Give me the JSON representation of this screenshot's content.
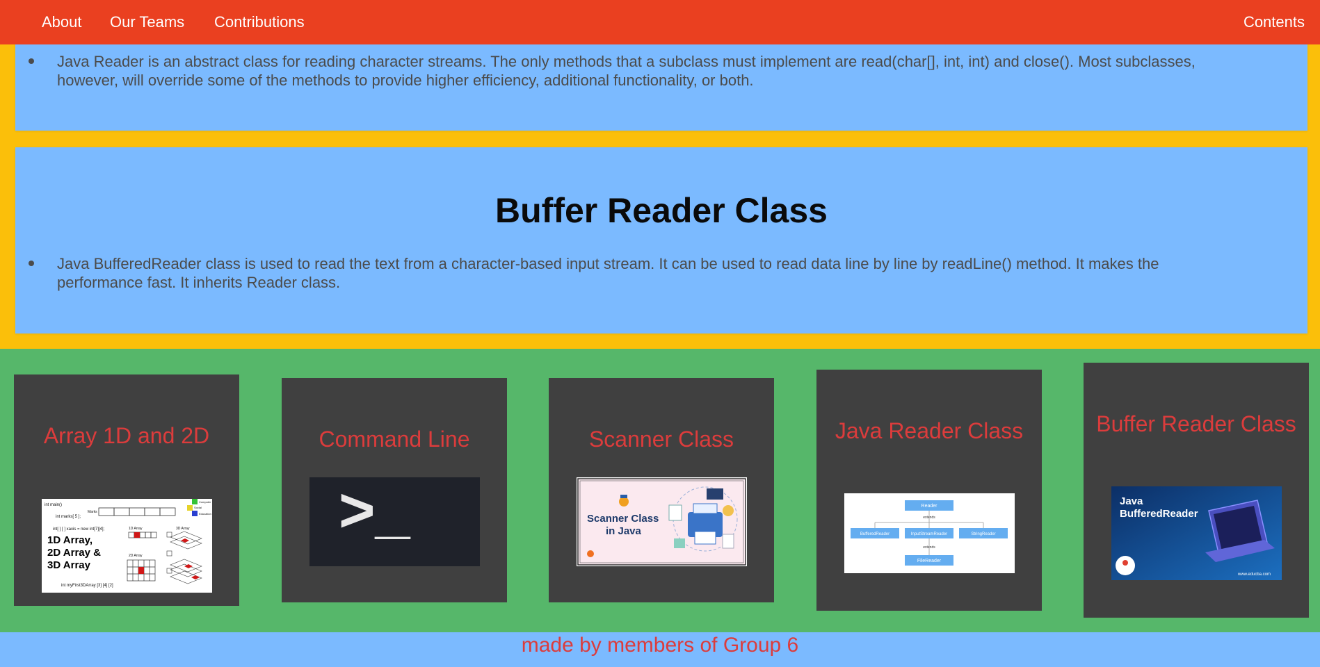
{
  "nav": {
    "about": "About",
    "our_teams": "Our Teams",
    "contributions": "Contributions",
    "contents": "Contents"
  },
  "sections": {
    "java_reader": {
      "text": "Java Reader is an abstract class for reading character streams. The only methods that a subclass must implement are read(char[], int, int) and close(). Most subclasses, however, will override some of the methods to provide higher efficiency, additional functionality, or both."
    },
    "buffer_reader": {
      "title": "Buffer Reader Class",
      "text": "Java BufferedReader class is used to read the text from a character-based input stream. It can be used to read data line by line by readLine() method. It makes the performance fast. It inherits Reader class."
    }
  },
  "cards": [
    {
      "title": "Array 1D and 2D",
      "image": {
        "headline": [
          "1D Array,",
          "2D Array &",
          "3D Array"
        ],
        "code_main": "int main()",
        "code_marks": "int marks[ 5 ];",
        "code_xaxis": "int[ ] [ ] xaxis = new int[7][4];",
        "code_3d": "int myFirst3DArray [3] [4] [2]",
        "marks_label": "Marks",
        "label_1d": "1D Array",
        "label_2d": "2D Array",
        "label_3d": "3D Array",
        "legend": [
          "Computer",
          "Social",
          "Education"
        ]
      }
    },
    {
      "title": "Command Line",
      "image": {
        "prompt": ">_"
      }
    },
    {
      "title": "Scanner Class",
      "image": {
        "caption_line1": "Scanner Class",
        "caption_line2": "in Java"
      }
    },
    {
      "title": "Java Reader Class",
      "image": {
        "root": "Reader",
        "extends_label": "extends",
        "children": [
          "BufferedReader",
          "InputStreamReader",
          "StringReader"
        ],
        "grandchild": "FileReader"
      }
    },
    {
      "title": "Buffer Reader Class",
      "image": {
        "line1": "Java",
        "line2": "BufferedReader",
        "watermark": "www.educba.com"
      }
    }
  ],
  "footer": {
    "text": "made by members of Group 6"
  },
  "colors": {
    "navbar": "#ea4020",
    "page_background": "#fbbf0a",
    "content_box": "#7bbaff",
    "card_section": "#56b76a",
    "card": "#404040",
    "card_title": "#dc3c3c"
  }
}
